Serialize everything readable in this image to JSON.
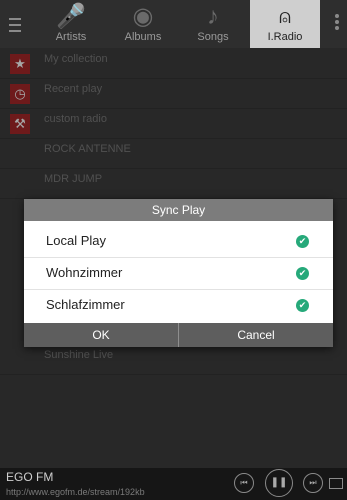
{
  "tabs": [
    {
      "label": "Artists",
      "icon": "microphone-icon",
      "glyph": "🎤"
    },
    {
      "label": "Albums",
      "icon": "disc-icon",
      "glyph": "◉"
    },
    {
      "label": "Songs",
      "icon": "music-note-icon",
      "glyph": "♪"
    },
    {
      "label": "I.Radio",
      "icon": "radio-tower-icon",
      "glyph": "⍝",
      "active": true
    }
  ],
  "list": [
    {
      "label": "My collection",
      "icon": "star-icon",
      "glyph": "★"
    },
    {
      "label": "Recent play",
      "icon": "clock-icon",
      "glyph": "◷"
    },
    {
      "label": "custom radio",
      "icon": "tools-icon",
      "glyph": "⚒"
    },
    {
      "label": "ROCK ANTENNE"
    },
    {
      "label": "MDR JUMP"
    },
    {
      "label": "Sunshine Live"
    }
  ],
  "dialog": {
    "title": "Sync Play",
    "options": [
      {
        "label": "Local Play",
        "checked": true
      },
      {
        "label": "Wohnzimmer",
        "checked": true
      },
      {
        "label": "Schlafzimmer",
        "checked": true
      }
    ],
    "ok_label": "OK",
    "cancel_label": "Cancel",
    "check_color": "#26a97a"
  },
  "player": {
    "station": "EGO FM",
    "url": "http://www.egofm.de/stream/192kb"
  },
  "colors": {
    "accent_red": "#a9282a",
    "active_tab": "#cfcfcf"
  }
}
